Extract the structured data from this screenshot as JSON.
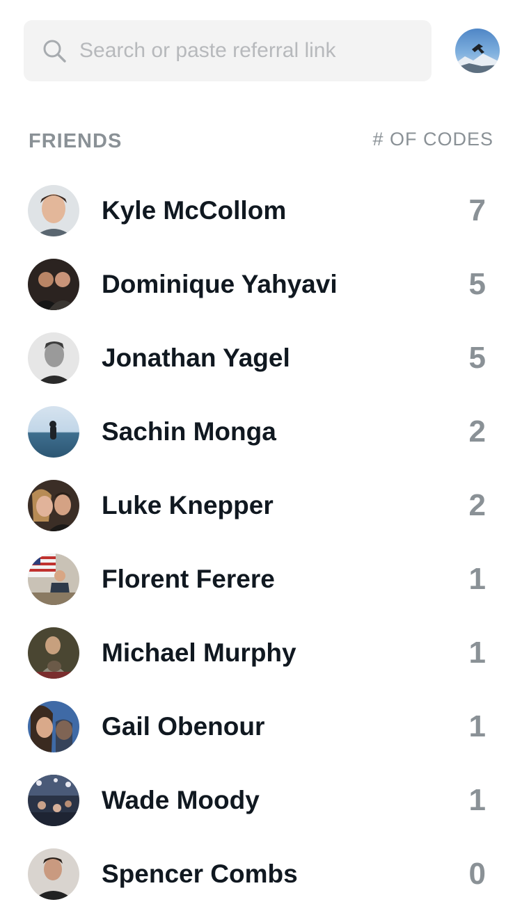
{
  "search": {
    "placeholder": "Search or paste referral link",
    "value": ""
  },
  "header": {
    "friends_label": "FRIENDS",
    "codes_label": "# OF CODES"
  },
  "colors": {
    "muted_text": "#8a9196",
    "primary_text": "#101820",
    "search_bg": "#f3f3f3"
  },
  "friends": [
    {
      "name": "Kyle McCollom",
      "codes": "7"
    },
    {
      "name": "Dominique Yahyavi",
      "codes": "5"
    },
    {
      "name": "Jonathan Yagel",
      "codes": "5"
    },
    {
      "name": "Sachin Monga",
      "codes": "2"
    },
    {
      "name": "Luke Knepper",
      "codes": "2"
    },
    {
      "name": "Florent Ferere",
      "codes": "1"
    },
    {
      "name": "Michael Murphy",
      "codes": "1"
    },
    {
      "name": "Gail Obenour",
      "codes": "1"
    },
    {
      "name": "Wade Moody",
      "codes": "1"
    },
    {
      "name": "Spencer Combs",
      "codes": "0"
    }
  ]
}
